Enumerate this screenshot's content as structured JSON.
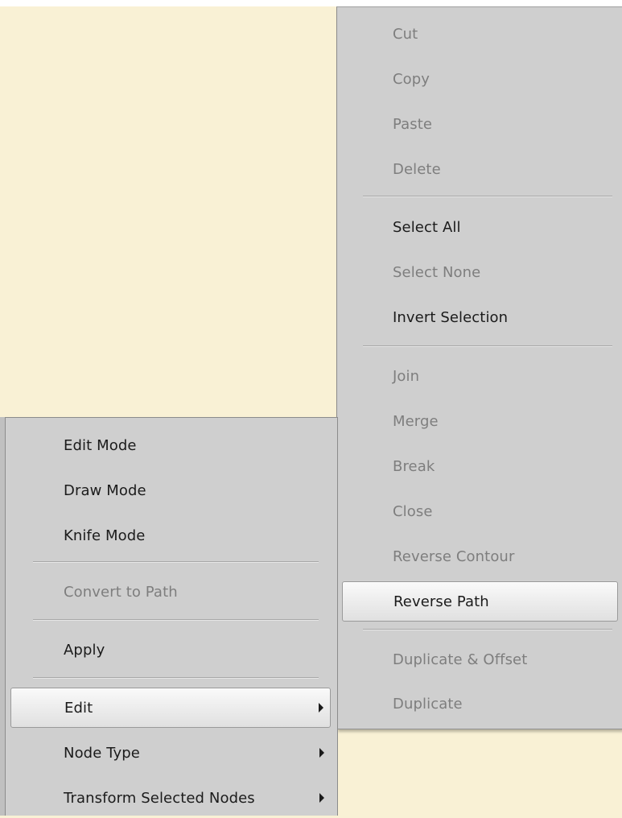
{
  "submenu": {
    "items": [
      {
        "label": "Cut",
        "enabled": false
      },
      {
        "label": "Copy",
        "enabled": false
      },
      {
        "label": "Paste",
        "enabled": false
      },
      {
        "label": "Delete",
        "enabled": false
      },
      {
        "label": "Select All",
        "enabled": true
      },
      {
        "label": "Select None",
        "enabled": false
      },
      {
        "label": "Invert Selection",
        "enabled": true
      },
      {
        "label": "Join",
        "enabled": false
      },
      {
        "label": "Merge",
        "enabled": false
      },
      {
        "label": "Break",
        "enabled": false
      },
      {
        "label": "Close",
        "enabled": false
      },
      {
        "label": "Reverse Contour",
        "enabled": false
      },
      {
        "label": "Reverse Path",
        "enabled": true,
        "highlighted": true
      },
      {
        "label": "Duplicate & Offset",
        "enabled": false
      },
      {
        "label": "Duplicate",
        "enabled": false
      }
    ]
  },
  "menu": {
    "items": [
      {
        "label": "Edit Mode",
        "enabled": true
      },
      {
        "label": "Draw Mode",
        "enabled": true
      },
      {
        "label": "Knife Mode",
        "enabled": true
      },
      {
        "label": "Convert to Path",
        "enabled": false
      },
      {
        "label": "Apply",
        "enabled": true
      },
      {
        "label": "Edit",
        "enabled": true,
        "highlighted": true,
        "has_submenu": true
      },
      {
        "label": "Node Type",
        "enabled": true,
        "has_submenu": true
      },
      {
        "label": "Transform Selected Nodes",
        "enabled": true,
        "has_submenu": true
      }
    ]
  },
  "colors": {
    "canvas": "#f9f1d5",
    "menu_background": "#cfcfcf",
    "text": "#1b1b1b",
    "disabled_text": "#7e7e7e"
  }
}
